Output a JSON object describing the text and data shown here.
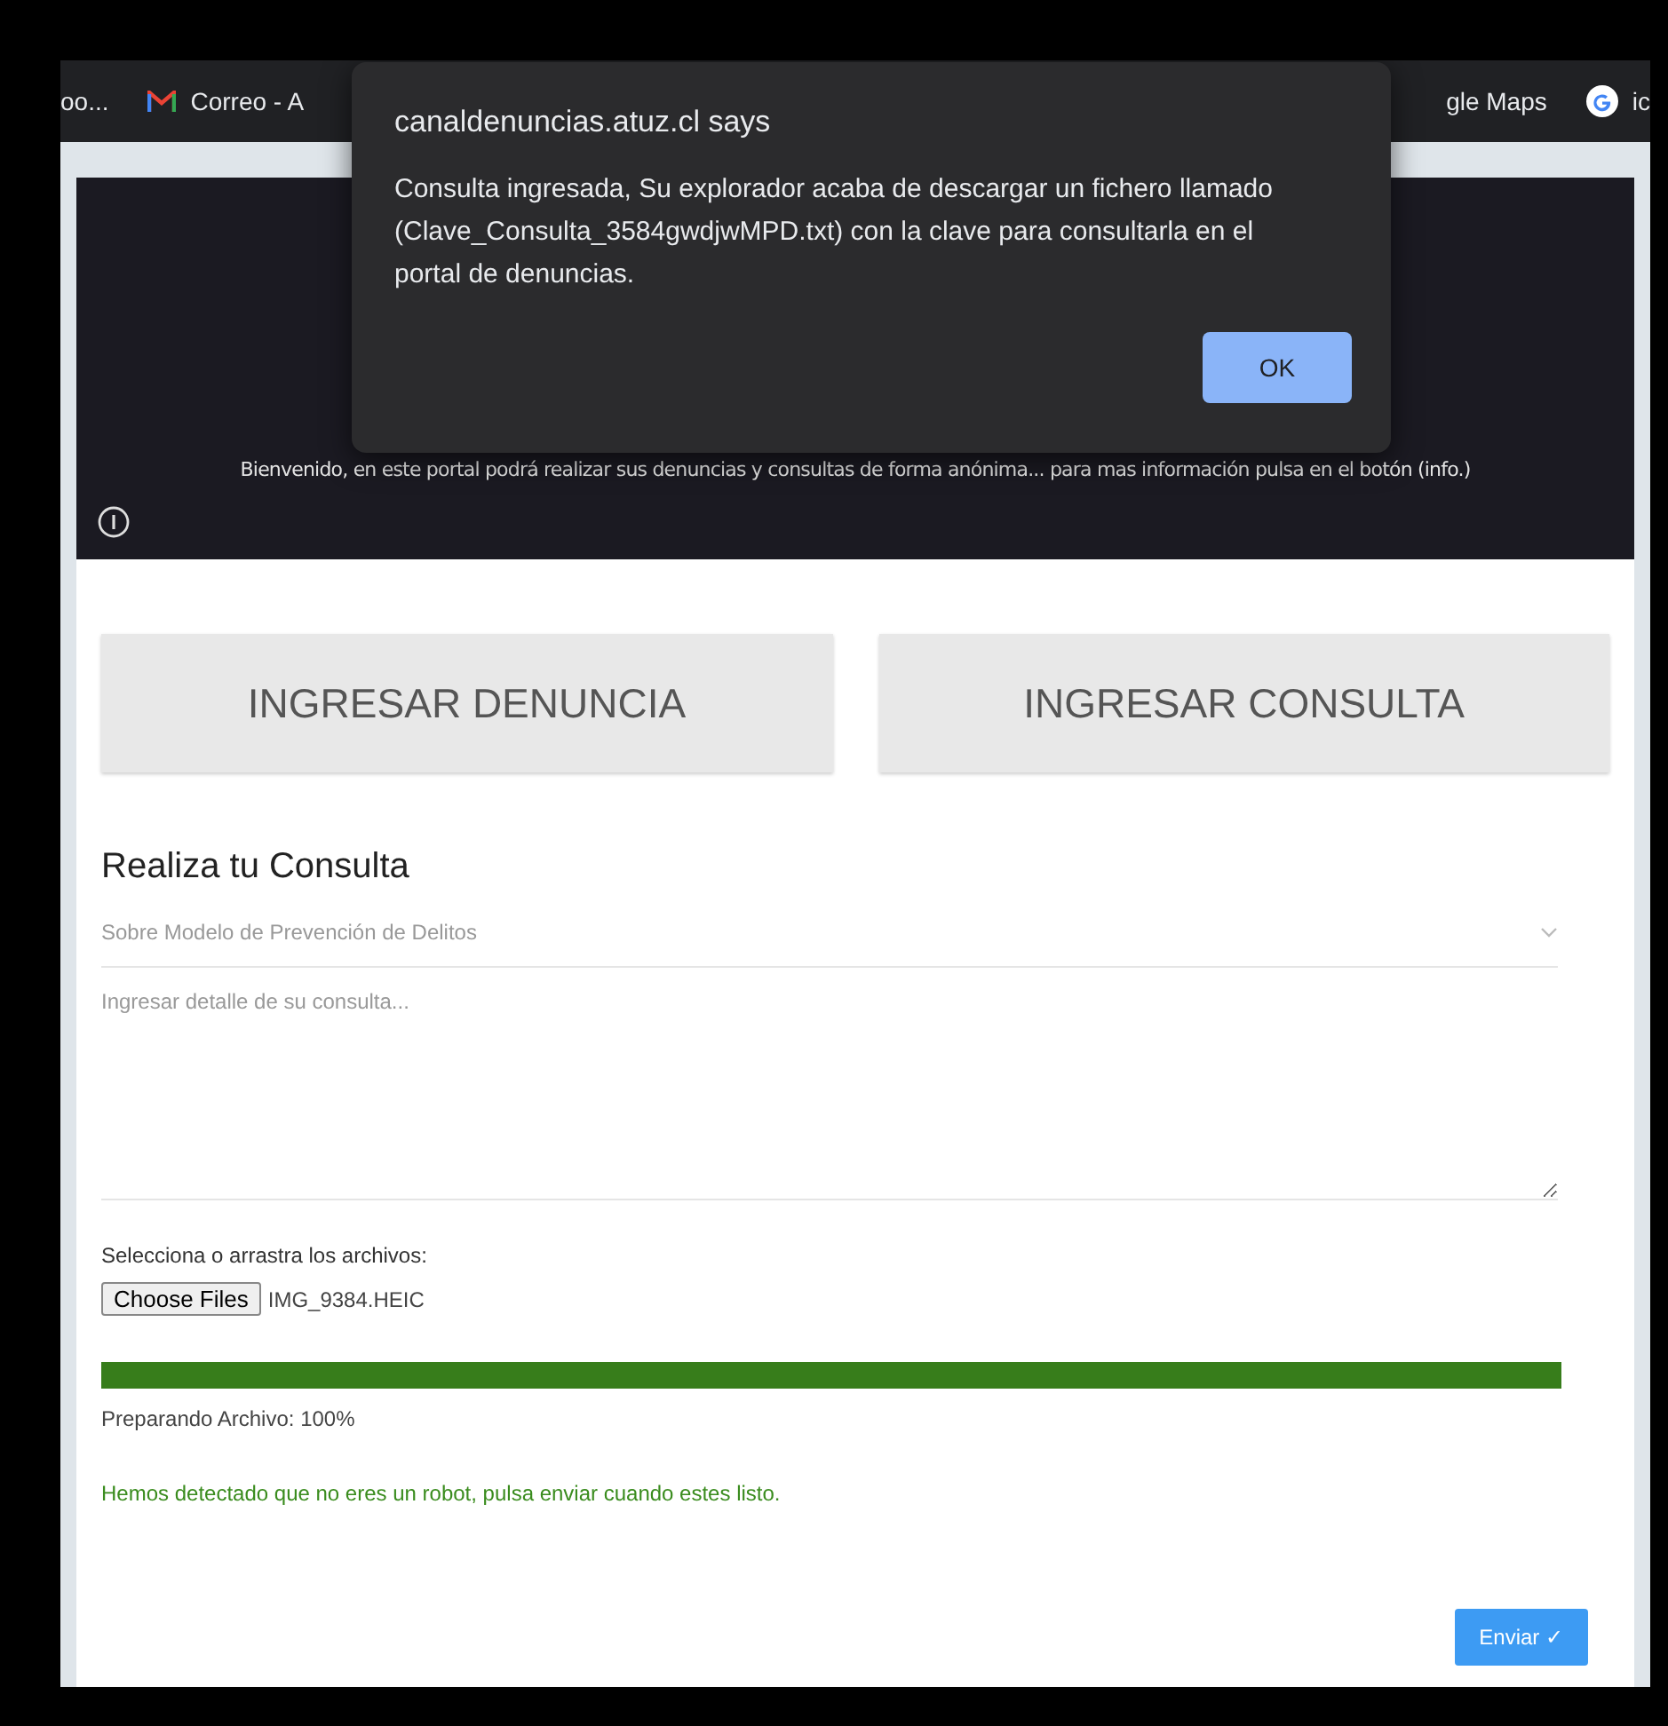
{
  "bookmarks_bar": {
    "items": [
      {
        "kind": "plain",
        "label": "oo..."
      },
      {
        "kind": "gmail",
        "label": "Correo - A"
      },
      {
        "kind": "plain",
        "label": "gle Maps"
      },
      {
        "kind": "google",
        "label": "ic"
      }
    ]
  },
  "header": {
    "welcome": "Bienvenido, en este portal podrá realizar sus denuncias y consultas de forma anónima... para mas información pulsa en el botón (info.)"
  },
  "actions": [
    {
      "label": "INGRESAR DENUNCIA"
    },
    {
      "label": "INGRESAR CONSULTA"
    }
  ],
  "form": {
    "title": "Realiza tu Consulta",
    "topic": {
      "value": "Sobre Modelo de Prevención de Delitos"
    },
    "detail": {
      "placeholder": "Ingresar detalle de su consulta..."
    },
    "files_label": "Selecciona o arrastra los archivos:",
    "choose_button": "Choose Files",
    "file_name": "IMG_9384.HEIC",
    "progress": {
      "level": 1
    },
    "progress_text": "Preparando Archivo: 100%",
    "robot_message": "Hemos detectado que no eres un robot, pulsa enviar cuando estes listo.",
    "submit": "Enviar ✓"
  },
  "dialog": {
    "title": "canaldenuncias.atuz.cl says",
    "message": "Consulta ingresada, Su explorador acaba de descargar un fichero llamado (Clave_Consulta_3584gwdjwMPD.txt) con la clave para consultarla en el portal de denuncias.",
    "ok": "OK"
  }
}
